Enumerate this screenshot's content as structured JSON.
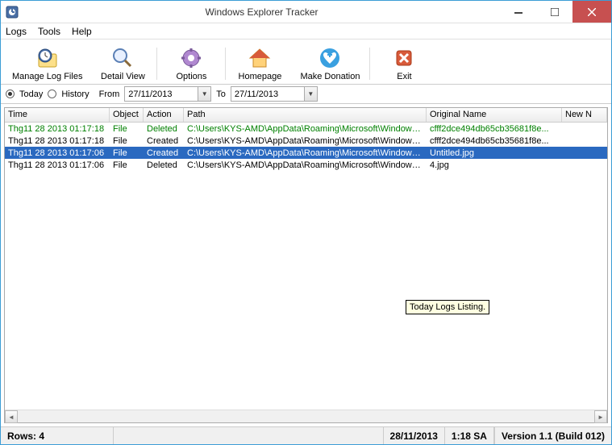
{
  "window": {
    "title": "Windows Explorer Tracker"
  },
  "menu": {
    "logs": "Logs",
    "tools": "Tools",
    "help": "Help"
  },
  "toolbar": {
    "manage": "Manage Log Files",
    "detail": "Detail View",
    "options": "Options",
    "homepage": "Homepage",
    "donate": "Make Donation",
    "exit": "Exit"
  },
  "filter": {
    "today": "Today",
    "history": "History",
    "from_lbl": "From",
    "to_lbl": "To",
    "from_date": "27/11/2013",
    "to_date": "27/11/2013"
  },
  "columns": {
    "time": "Time",
    "object": "Object",
    "action": "Action",
    "path": "Path",
    "original": "Original Name",
    "newn": "New N"
  },
  "rows": [
    {
      "time": "Thg11 28 2013 01:17:18",
      "object": "File",
      "action": "Deleted",
      "path": "C:\\Users\\KYS-AMD\\AppData\\Roaming\\Microsoft\\Windows\\...",
      "original": "cfff2dce494db65cb35681f8e...",
      "cls": "green"
    },
    {
      "time": "Thg11 28 2013 01:17:18",
      "object": "File",
      "action": "Created",
      "path": "C:\\Users\\KYS-AMD\\AppData\\Roaming\\Microsoft\\Windows\\...",
      "original": "cfff2dce494db65cb35681f8e...",
      "cls": ""
    },
    {
      "time": "Thg11 28 2013 01:17:06",
      "object": "File",
      "action": "Created",
      "path": "C:\\Users\\KYS-AMD\\AppData\\Roaming\\Microsoft\\Windows\\...",
      "original": "Untitled.jpg",
      "cls": "sel"
    },
    {
      "time": "Thg11 28 2013 01:17:06",
      "object": "File",
      "action": "Deleted",
      "path": "C:\\Users\\KYS-AMD\\AppData\\Roaming\\Microsoft\\Windows\\...",
      "original": "4.jpg",
      "cls": ""
    }
  ],
  "tooltip": "Today Logs Listing.",
  "status": {
    "rows": "Rows: 4",
    "date": "28/11/2013",
    "time": "1:18 SA",
    "version": "Version 1.1 (Build 012)"
  }
}
